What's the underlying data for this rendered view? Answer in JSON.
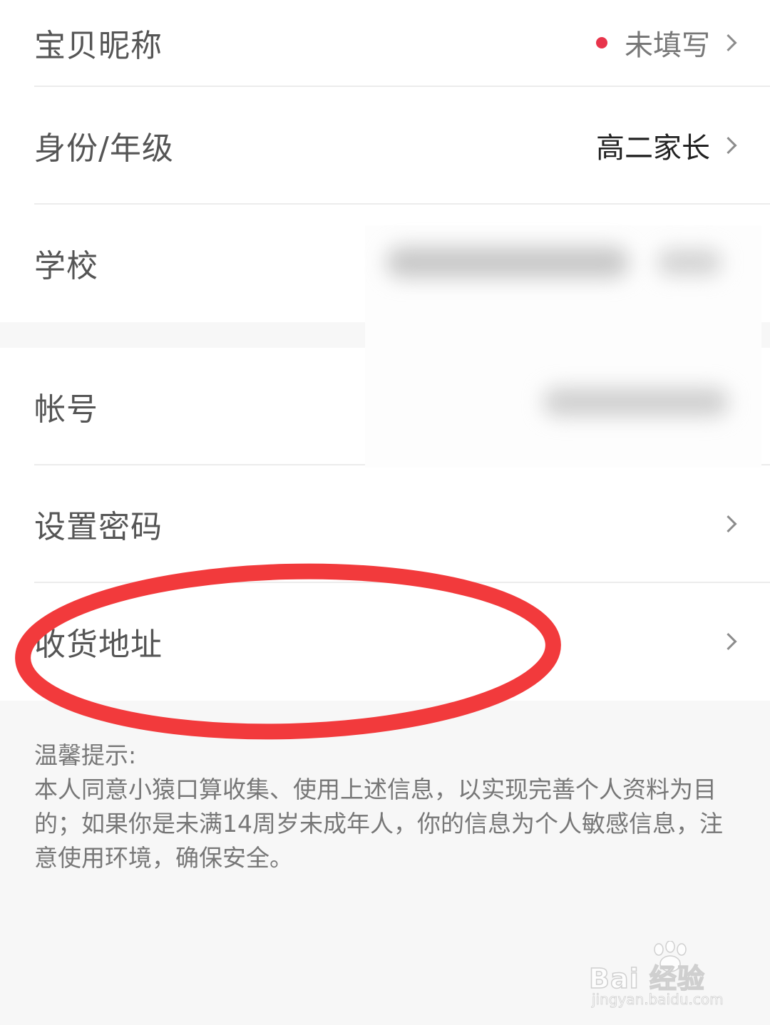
{
  "profile": {
    "rows": [
      {
        "label": "宝贝昵称",
        "value": "未填写",
        "has_dot": true,
        "has_chevron": true
      },
      {
        "label": "身份/年级",
        "value": "高二家长",
        "has_chevron": true
      },
      {
        "label": "学校",
        "value": null,
        "blurred": true
      },
      {
        "label": "帐号",
        "value": null,
        "blurred": true
      },
      {
        "label": "设置密码",
        "value": null,
        "has_chevron": true
      },
      {
        "label": "收货地址",
        "value": null,
        "has_chevron": true,
        "annotated": true
      }
    ]
  },
  "tips": {
    "title": "温馨提示:",
    "body": "本人同意小猿口算收集、使用上述信息，以实现完善个人资料为目的；如果你是未满14周岁未成年人，你的信息为个人敏感信息，注意使用环境，确保安全。"
  },
  "colors": {
    "accent_dot": "#e8344b",
    "annotation_ring": "#f23a3c",
    "page_bg": "#f7f7f7",
    "row_bg": "#ffffff"
  },
  "watermark": {
    "brand": "Bai 经验",
    "url": "jingyan.baidu.com"
  }
}
